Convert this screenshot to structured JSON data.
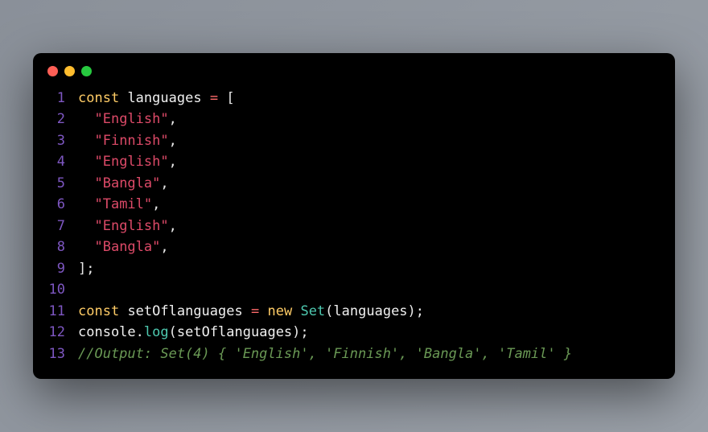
{
  "window": {
    "dots": [
      "red",
      "yellow",
      "green"
    ]
  },
  "colors": {
    "keyword": "#ffcc66",
    "identifier": "#f0f0f0",
    "operator": "#ff6b6b",
    "string": "#dd4a68",
    "class": "#4ec9b0",
    "comment": "#6a9955",
    "gutter": "#7e57c2",
    "background": "#000000"
  },
  "code": {
    "lines": [
      {
        "num": "1",
        "tokens": [
          [
            "kw",
            "const"
          ],
          [
            "",
            " "
          ],
          [
            "ident",
            "languages"
          ],
          [
            "",
            " "
          ],
          [
            "op",
            "="
          ],
          [
            "",
            " "
          ],
          [
            "punc",
            "["
          ]
        ]
      },
      {
        "num": "2",
        "tokens": [
          [
            "",
            "  "
          ],
          [
            "str",
            "\"English\""
          ],
          [
            "punc",
            ","
          ]
        ]
      },
      {
        "num": "3",
        "tokens": [
          [
            "",
            "  "
          ],
          [
            "str",
            "\"Finnish\""
          ],
          [
            "punc",
            ","
          ]
        ]
      },
      {
        "num": "4",
        "tokens": [
          [
            "",
            "  "
          ],
          [
            "str",
            "\"English\""
          ],
          [
            "punc",
            ","
          ]
        ]
      },
      {
        "num": "5",
        "tokens": [
          [
            "",
            "  "
          ],
          [
            "str",
            "\"Bangla\""
          ],
          [
            "punc",
            ","
          ]
        ]
      },
      {
        "num": "6",
        "tokens": [
          [
            "",
            "  "
          ],
          [
            "str",
            "\"Tamil\""
          ],
          [
            "punc",
            ","
          ]
        ]
      },
      {
        "num": "7",
        "tokens": [
          [
            "",
            "  "
          ],
          [
            "str",
            "\"English\""
          ],
          [
            "punc",
            ","
          ]
        ]
      },
      {
        "num": "8",
        "tokens": [
          [
            "",
            "  "
          ],
          [
            "str",
            "\"Bangla\""
          ],
          [
            "punc",
            ","
          ]
        ]
      },
      {
        "num": "9",
        "tokens": [
          [
            "punc",
            "];"
          ]
        ]
      },
      {
        "num": "10",
        "tokens": []
      },
      {
        "num": "11",
        "tokens": [
          [
            "kw",
            "const"
          ],
          [
            "",
            " "
          ],
          [
            "ident",
            "setOflanguages"
          ],
          [
            "",
            " "
          ],
          [
            "op",
            "="
          ],
          [
            "",
            " "
          ],
          [
            "kw",
            "new"
          ],
          [
            "",
            " "
          ],
          [
            "cls",
            "Set"
          ],
          [
            "punc",
            "("
          ],
          [
            "ident",
            "languages"
          ],
          [
            "punc",
            ");"
          ]
        ]
      },
      {
        "num": "12",
        "tokens": [
          [
            "ident",
            "console"
          ],
          [
            "punc",
            "."
          ],
          [
            "fn",
            "log"
          ],
          [
            "punc",
            "("
          ],
          [
            "ident",
            "setOflanguages"
          ],
          [
            "punc",
            ");"
          ]
        ]
      },
      {
        "num": "13",
        "tokens": [
          [
            "comment",
            "//Output: Set(4) { 'English', 'Finnish', 'Bangla', 'Tamil' }"
          ]
        ]
      }
    ]
  }
}
